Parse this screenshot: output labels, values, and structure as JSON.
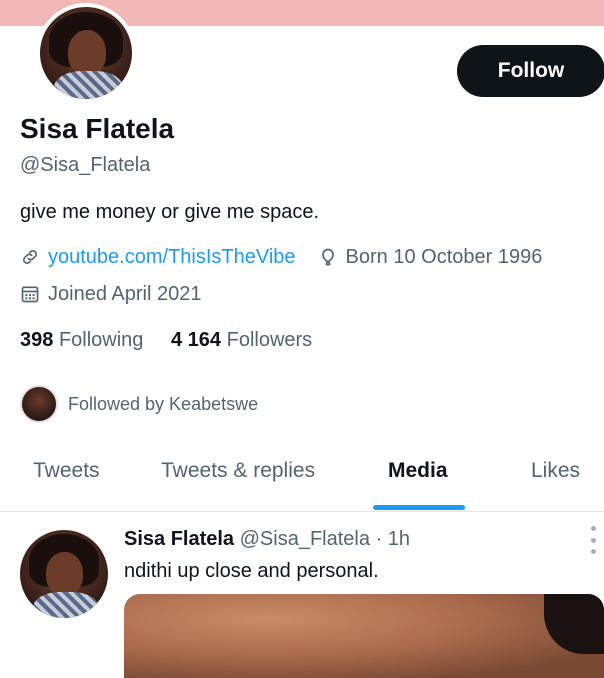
{
  "profile": {
    "display_name": "Sisa Flatela",
    "handle": "@Sisa_Flatela",
    "bio": "give me money or give me space.",
    "link": "youtube.com/ThisIsTheVibe",
    "born": "Born 10 October 1996",
    "joined": "Joined April 2021",
    "following_count": "398",
    "following_label": "Following",
    "followers_count": "4 164",
    "followers_label": "Followers",
    "followed_by": "Followed by Keabetswe"
  },
  "actions": {
    "follow_label": "Follow"
  },
  "tabs": [
    {
      "label": "Tweets"
    },
    {
      "label": "Tweets & replies"
    },
    {
      "label": "Media",
      "active": true
    },
    {
      "label": "Likes"
    }
  ],
  "tweet": {
    "name": "Sisa Flatela",
    "handle": "@Sisa_Flatela",
    "time": "· 1h",
    "text": "ndithi up close and personal."
  },
  "colors": {
    "accent": "#1d9bf0",
    "banner": "#f2b8b8",
    "button": "#0f1419"
  },
  "icons": [
    "link-icon",
    "birthday-icon",
    "calendar-icon",
    "more-icon"
  ]
}
